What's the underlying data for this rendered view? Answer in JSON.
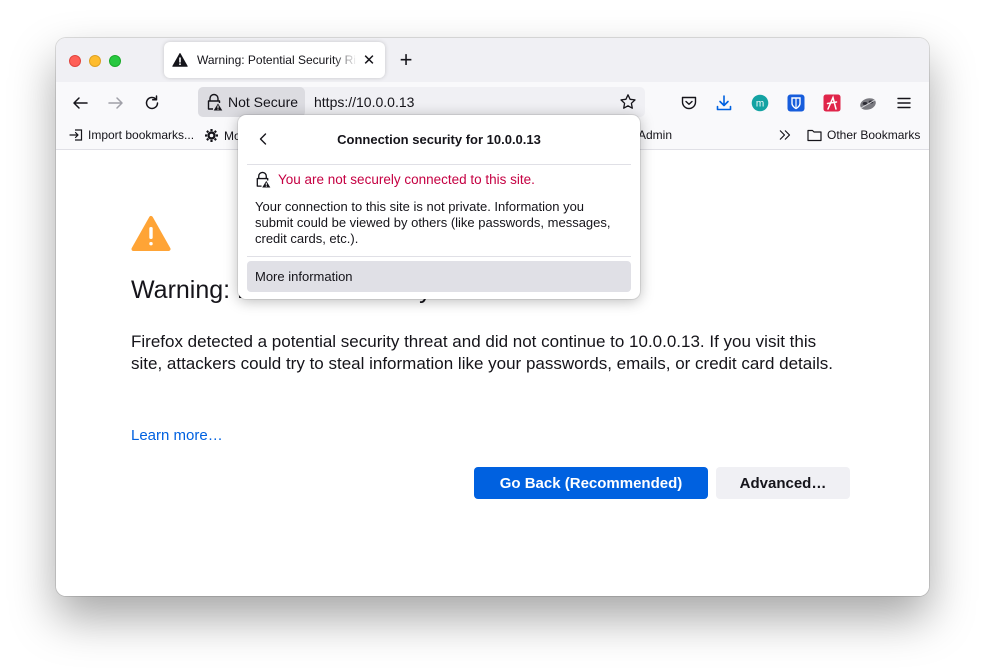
{
  "window": {
    "tab": {
      "title": "Warning: Potential Security Risk Ahead",
      "icon": "warning-icon",
      "close_icon": "close-icon"
    },
    "new_tab_icon": "plus-icon"
  },
  "navbar": {
    "back_icon": "arrow-left-icon",
    "forward_icon": "arrow-right-icon",
    "reload_icon": "reload-icon",
    "identity_label": "Not Secure",
    "url": "https://10.0.0.13",
    "bookmark_star_icon": "star-icon",
    "toolbar_icons": [
      "pocket-icon",
      "download-icon",
      "extension-m-icon",
      "bitwarden-icon",
      "extension-a-icon",
      "extension-raccoon-icon",
      "menu-icon"
    ],
    "colors": {
      "download": "#0061e0",
      "extension_m": "#14a3a3",
      "bitwarden": "#175ddc",
      "extension_a": "#e0254a"
    }
  },
  "bookmarks": {
    "items": [
      {
        "label": "Import bookmarks...",
        "icon": "import-icon"
      },
      {
        "label": "Mo",
        "icon": "gear-icon"
      },
      {
        "label": "Admin",
        "icon": ""
      }
    ],
    "overflow_icon": "chevron-double-right-icon",
    "other": {
      "label": "Other Bookmarks",
      "icon": "folder-icon"
    }
  },
  "page": {
    "heading": "Warning: Potential Security Risk Ahead",
    "description": "Firefox detected a potential security threat and did not continue to 10.0.0.13. If you visit this site, attackers could try to steal information like your passwords, emails, or credit card details.",
    "learn_more": "Learn more…",
    "go_back_button": "Go Back (Recommended)",
    "advanced_button": "Advanced…",
    "colors": {
      "warning": "#ffa436",
      "primary": "#0061e0"
    }
  },
  "panel": {
    "title": "Connection security for 10.0.0.13",
    "status": "You are not securely connected to this site.",
    "body": "Your connection to this site is not private. Information you submit could be viewed by others (like passwords, messages, credit cards, etc.).",
    "more_info": "More information",
    "colors": {
      "status": "#c50042"
    }
  }
}
